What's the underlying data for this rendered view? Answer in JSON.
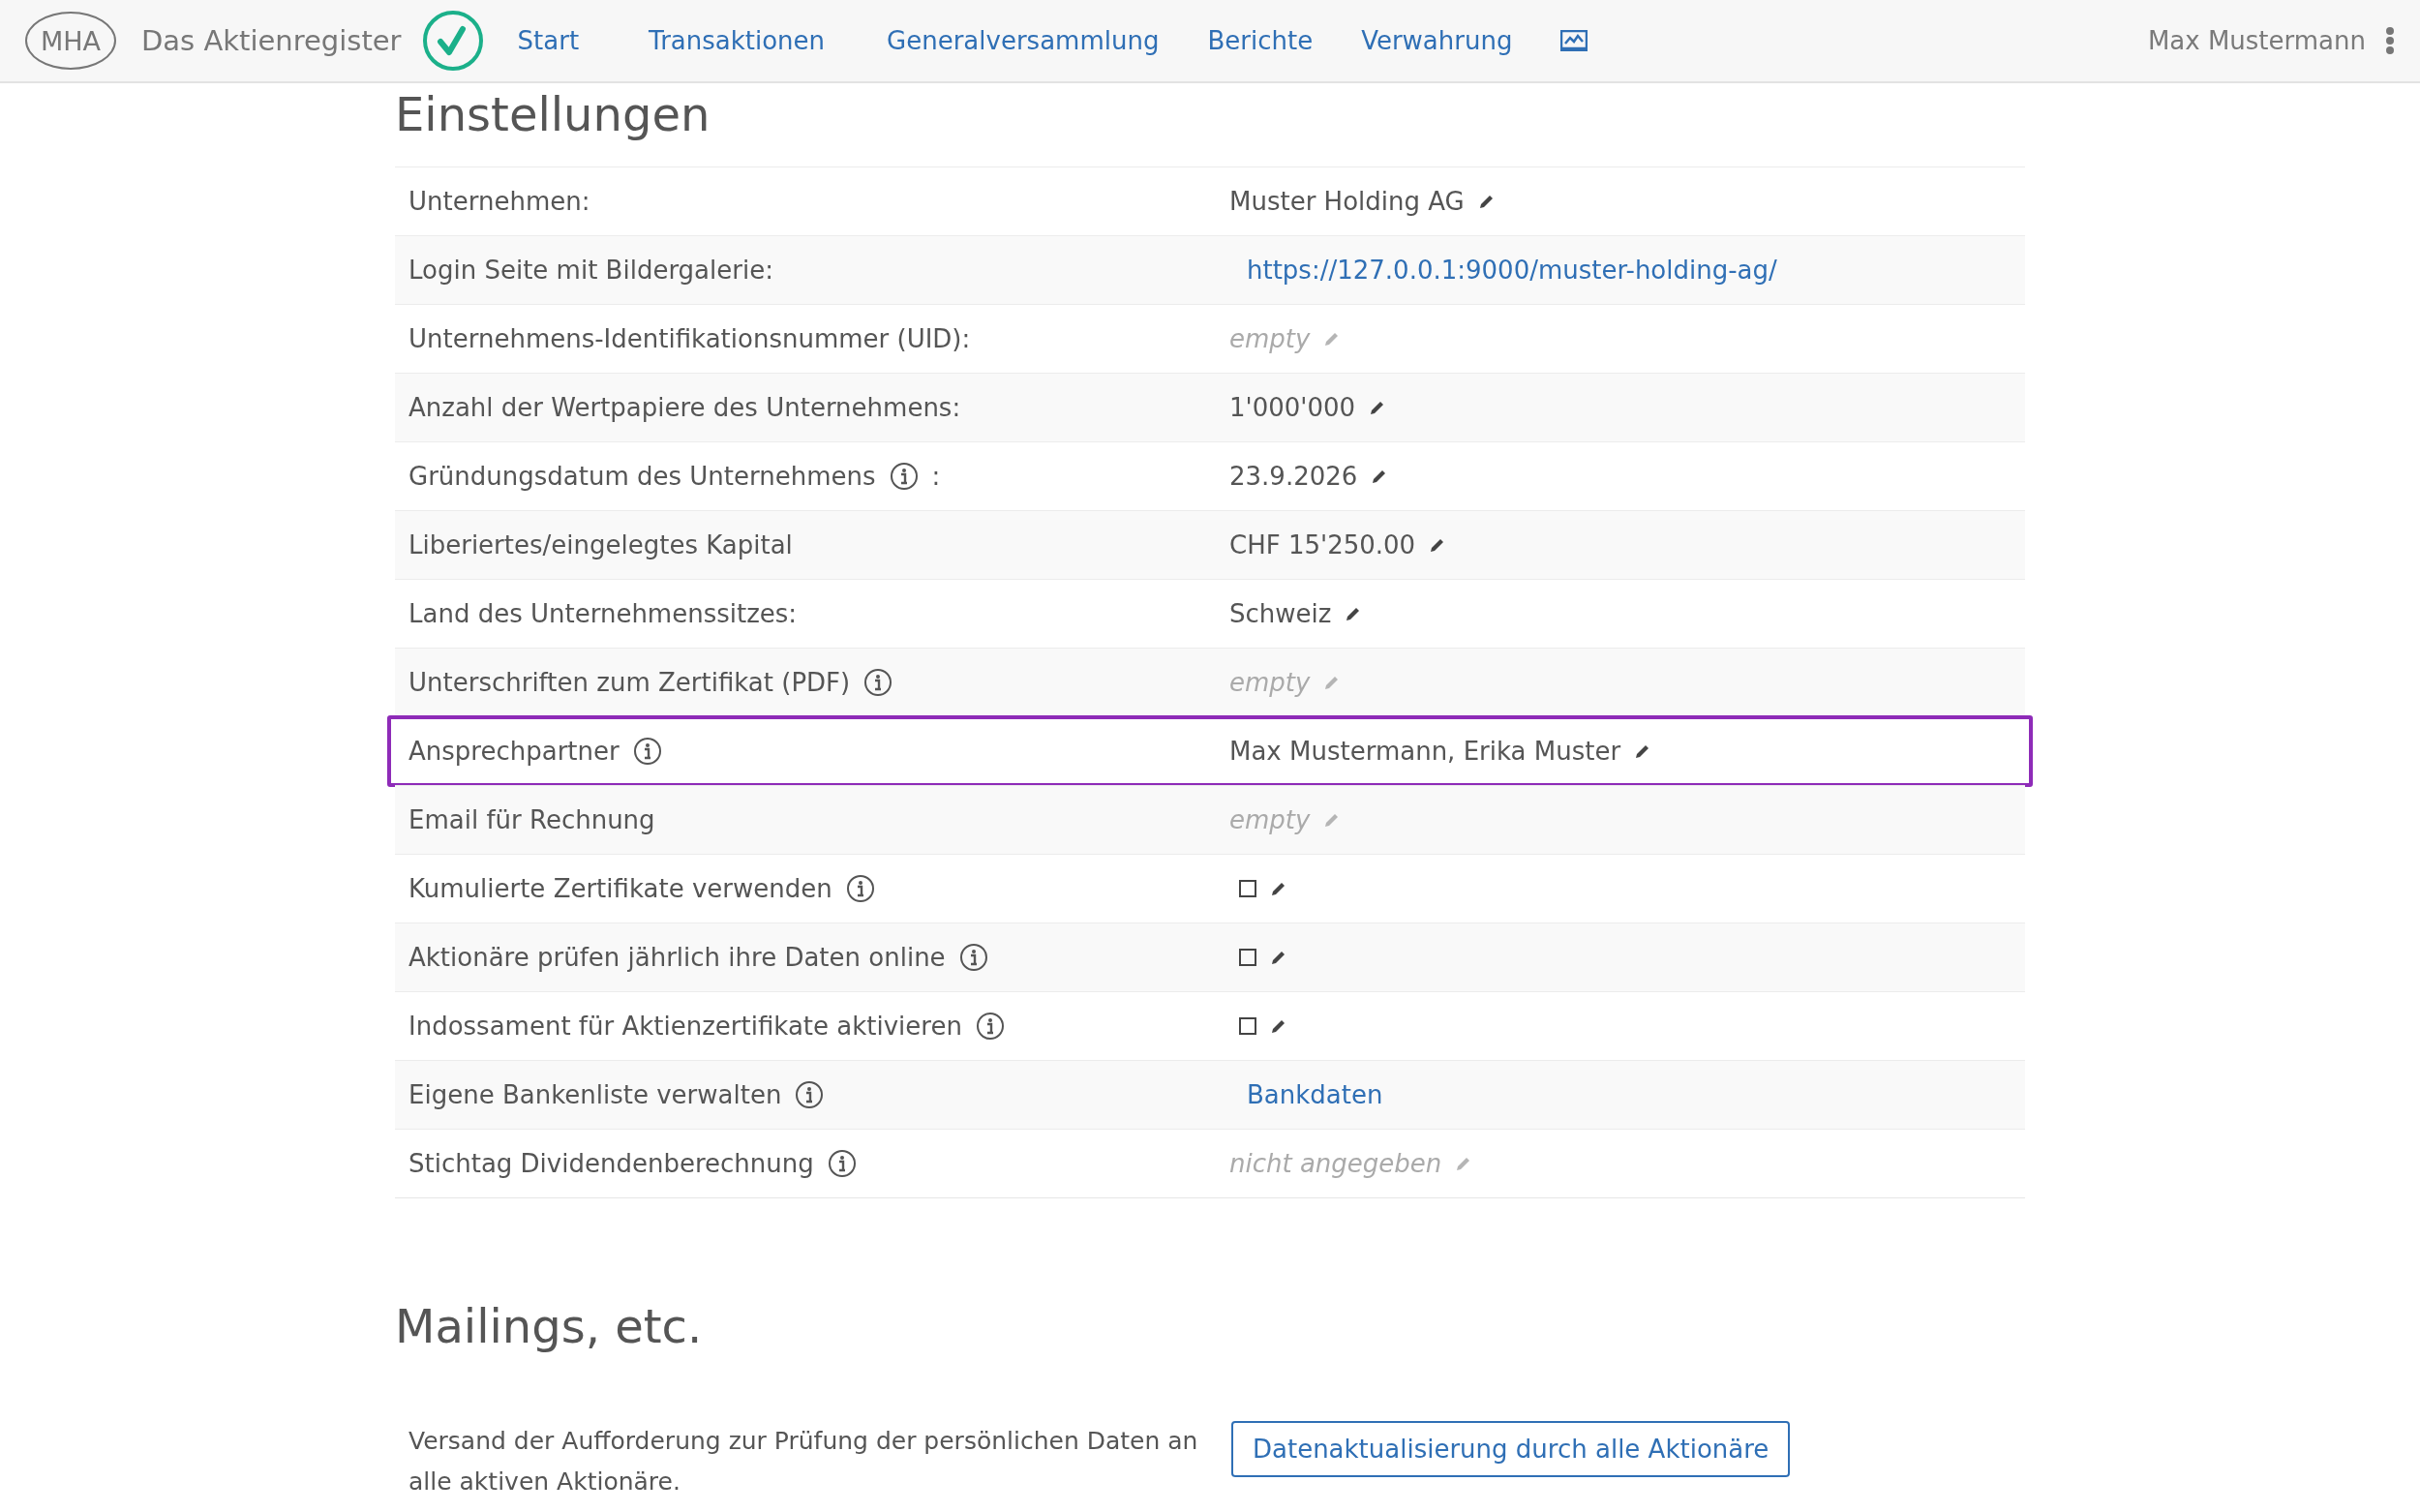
{
  "navbar": {
    "logo": "MHA",
    "brand": "Das Aktienregister",
    "links": [
      {
        "label": "Start"
      },
      {
        "label": "Transaktionen"
      },
      {
        "label": "Generalversammlung"
      },
      {
        "label": "Berichte"
      },
      {
        "label": "Verwahrung"
      }
    ],
    "user": "Max Mustermann"
  },
  "settings": {
    "title": "Einstellungen",
    "rows": [
      {
        "label": "Unternehmen:",
        "info": false,
        "kind": "text",
        "value": "Muster Holding AG",
        "editable": true,
        "highlighted": false
      },
      {
        "label": "Login Seite mit Bildergalerie:",
        "info": false,
        "kind": "link",
        "value": "https://127.0.0.1:9000/muster-holding-ag/",
        "editable": false,
        "highlighted": false
      },
      {
        "label": "Unternehmens-Identifikationsnummer (UID):",
        "info": false,
        "kind": "empty",
        "value": "empty",
        "editable": true,
        "highlighted": false
      },
      {
        "label": "Anzahl der Wertpapiere des Unternehmens:",
        "info": false,
        "kind": "text",
        "value": "1'000'000",
        "editable": true,
        "highlighted": false
      },
      {
        "label": "Gründungsdatum des Unternehmens",
        "info": true,
        "label_suffix": ":",
        "kind": "text",
        "value": "23.9.2026",
        "editable": true,
        "highlighted": false
      },
      {
        "label": "Liberiertes/eingelegtes Kapital",
        "info": false,
        "kind": "text",
        "value": "CHF 15'250.00",
        "editable": true,
        "highlighted": false
      },
      {
        "label": "Land des Unternehmenssitzes:",
        "info": false,
        "kind": "text",
        "value": "Schweiz",
        "editable": true,
        "highlighted": false
      },
      {
        "label": "Unterschriften zum Zertifikat (PDF)",
        "info": true,
        "kind": "empty",
        "value": "empty",
        "editable": true,
        "highlighted": false
      },
      {
        "label": "Ansprechpartner",
        "info": true,
        "kind": "text",
        "value": "Max Mustermann, Erika Muster",
        "editable": true,
        "highlighted": true
      },
      {
        "label": "Email für Rechnung",
        "info": false,
        "kind": "empty",
        "value": "empty",
        "editable": true,
        "highlighted": false
      },
      {
        "label": "Kumulierte Zertifikate verwenden",
        "info": true,
        "kind": "checkbox",
        "checked": false,
        "editable": true,
        "highlighted": false
      },
      {
        "label": "Aktionäre prüfen jährlich ihre Daten online",
        "info": true,
        "kind": "checkbox",
        "checked": false,
        "editable": true,
        "highlighted": false
      },
      {
        "label": "Indossament für Aktienzertifikate aktivieren",
        "info": true,
        "kind": "checkbox",
        "checked": false,
        "editable": true,
        "highlighted": false
      },
      {
        "label": "Eigene Bankenliste verwalten",
        "info": true,
        "kind": "link",
        "value": "Bankdaten",
        "editable": false,
        "highlighted": false
      },
      {
        "label": "Stichtag Dividendenberechnung",
        "info": true,
        "kind": "empty",
        "value": "nicht angegeben",
        "editable": true,
        "highlighted": false
      }
    ]
  },
  "mailings": {
    "title": "Mailings, etc.",
    "description": "Versand der Aufforderung zur Prüfung der persönlichen Daten an alle aktiven Aktionäre.",
    "button": "Datenaktualisierung durch alle Aktionäre"
  }
}
